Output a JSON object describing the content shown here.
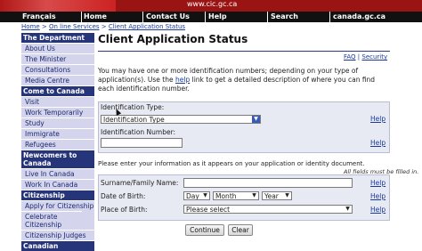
{
  "banner": {
    "url": "www.cic.gc.ca"
  },
  "nav": {
    "items": [
      "Français",
      "Home",
      "Contact Us",
      "Help",
      "Search",
      "canada.gc.ca"
    ]
  },
  "breadcrumb": {
    "home": "Home",
    "sep1": ">",
    "online": "On line Services",
    "sep2": ">",
    "current": "Client Application Status"
  },
  "sidebar": {
    "sections": [
      {
        "heading": "The Department",
        "items": [
          "About Us",
          "The Minister",
          "Consultations",
          "Media Centre"
        ]
      },
      {
        "heading": "Come to Canada",
        "items": [
          "Visit",
          "Work Temporarily",
          "Study",
          "Immigrate",
          "Refugees"
        ]
      },
      {
        "heading": "Newcomers to Canada",
        "items": [
          "Live In Canada",
          "Work In Canada"
        ]
      },
      {
        "heading": "Citizenship",
        "items": [
          "Apply for Citizenship",
          "Celebrate Citizenship",
          "Citizenship Judges"
        ]
      },
      {
        "heading": "Canadian",
        "items": []
      }
    ]
  },
  "page": {
    "title": "Client Application Status",
    "faq": "FAQ",
    "security": "Security",
    "links_sep": "|",
    "intro_part1": "You may have one or more identification numbers; depending on your type of application(s). Use the",
    "intro_link": "help",
    "intro_part2": "link to get a detailed description of where you can find each identification number."
  },
  "id_form": {
    "type_label": "Identification Type:",
    "type_selected": "Identification Type",
    "number_label": "Identification Number:",
    "help": "Help"
  },
  "info": {
    "instruction": "Please enter your information as it appears on your application or identity document.",
    "required_note": "All fields must be filled in."
  },
  "personal_form": {
    "surname_label": "Surname/Family Name:",
    "dob_label": "Date of Birth:",
    "day": "Day",
    "month": "Month",
    "year": "Year",
    "pob_label": "Place of Birth:",
    "pob_selected": "Please select",
    "help": "Help"
  },
  "actions": {
    "continue": "Continue",
    "clear": "Clear"
  },
  "colors": {
    "banner_red": "#9a1414",
    "nav_black": "#111111",
    "sidebar_heading": "#26347a",
    "sidebar_bg": "#d4d4ec",
    "link_blue": "#1a3a9a",
    "panel_bg": "#e7e9f3"
  }
}
